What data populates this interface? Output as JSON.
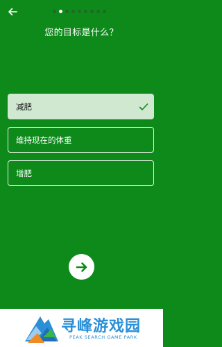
{
  "header": {
    "back_icon": "arrow-left-icon",
    "progress": {
      "total": 9,
      "current": 2
    },
    "title": "您的目标是什么？"
  },
  "options": [
    {
      "label": "减肥",
      "selected": true
    },
    {
      "label": "维持现在的体重",
      "selected": false
    },
    {
      "label": "增肥",
      "selected": false
    }
  ],
  "next_button": {
    "icon": "arrow-right-icon"
  },
  "watermark": {
    "cn": "寻峰游戏园",
    "en": "PEAK SEARCH GAME PARK"
  },
  "colors": {
    "background": "#0e8a1b",
    "selected_bg": "#cfe8cf",
    "check": "#0e8a1b",
    "watermark_text": "#2a8fd6"
  }
}
